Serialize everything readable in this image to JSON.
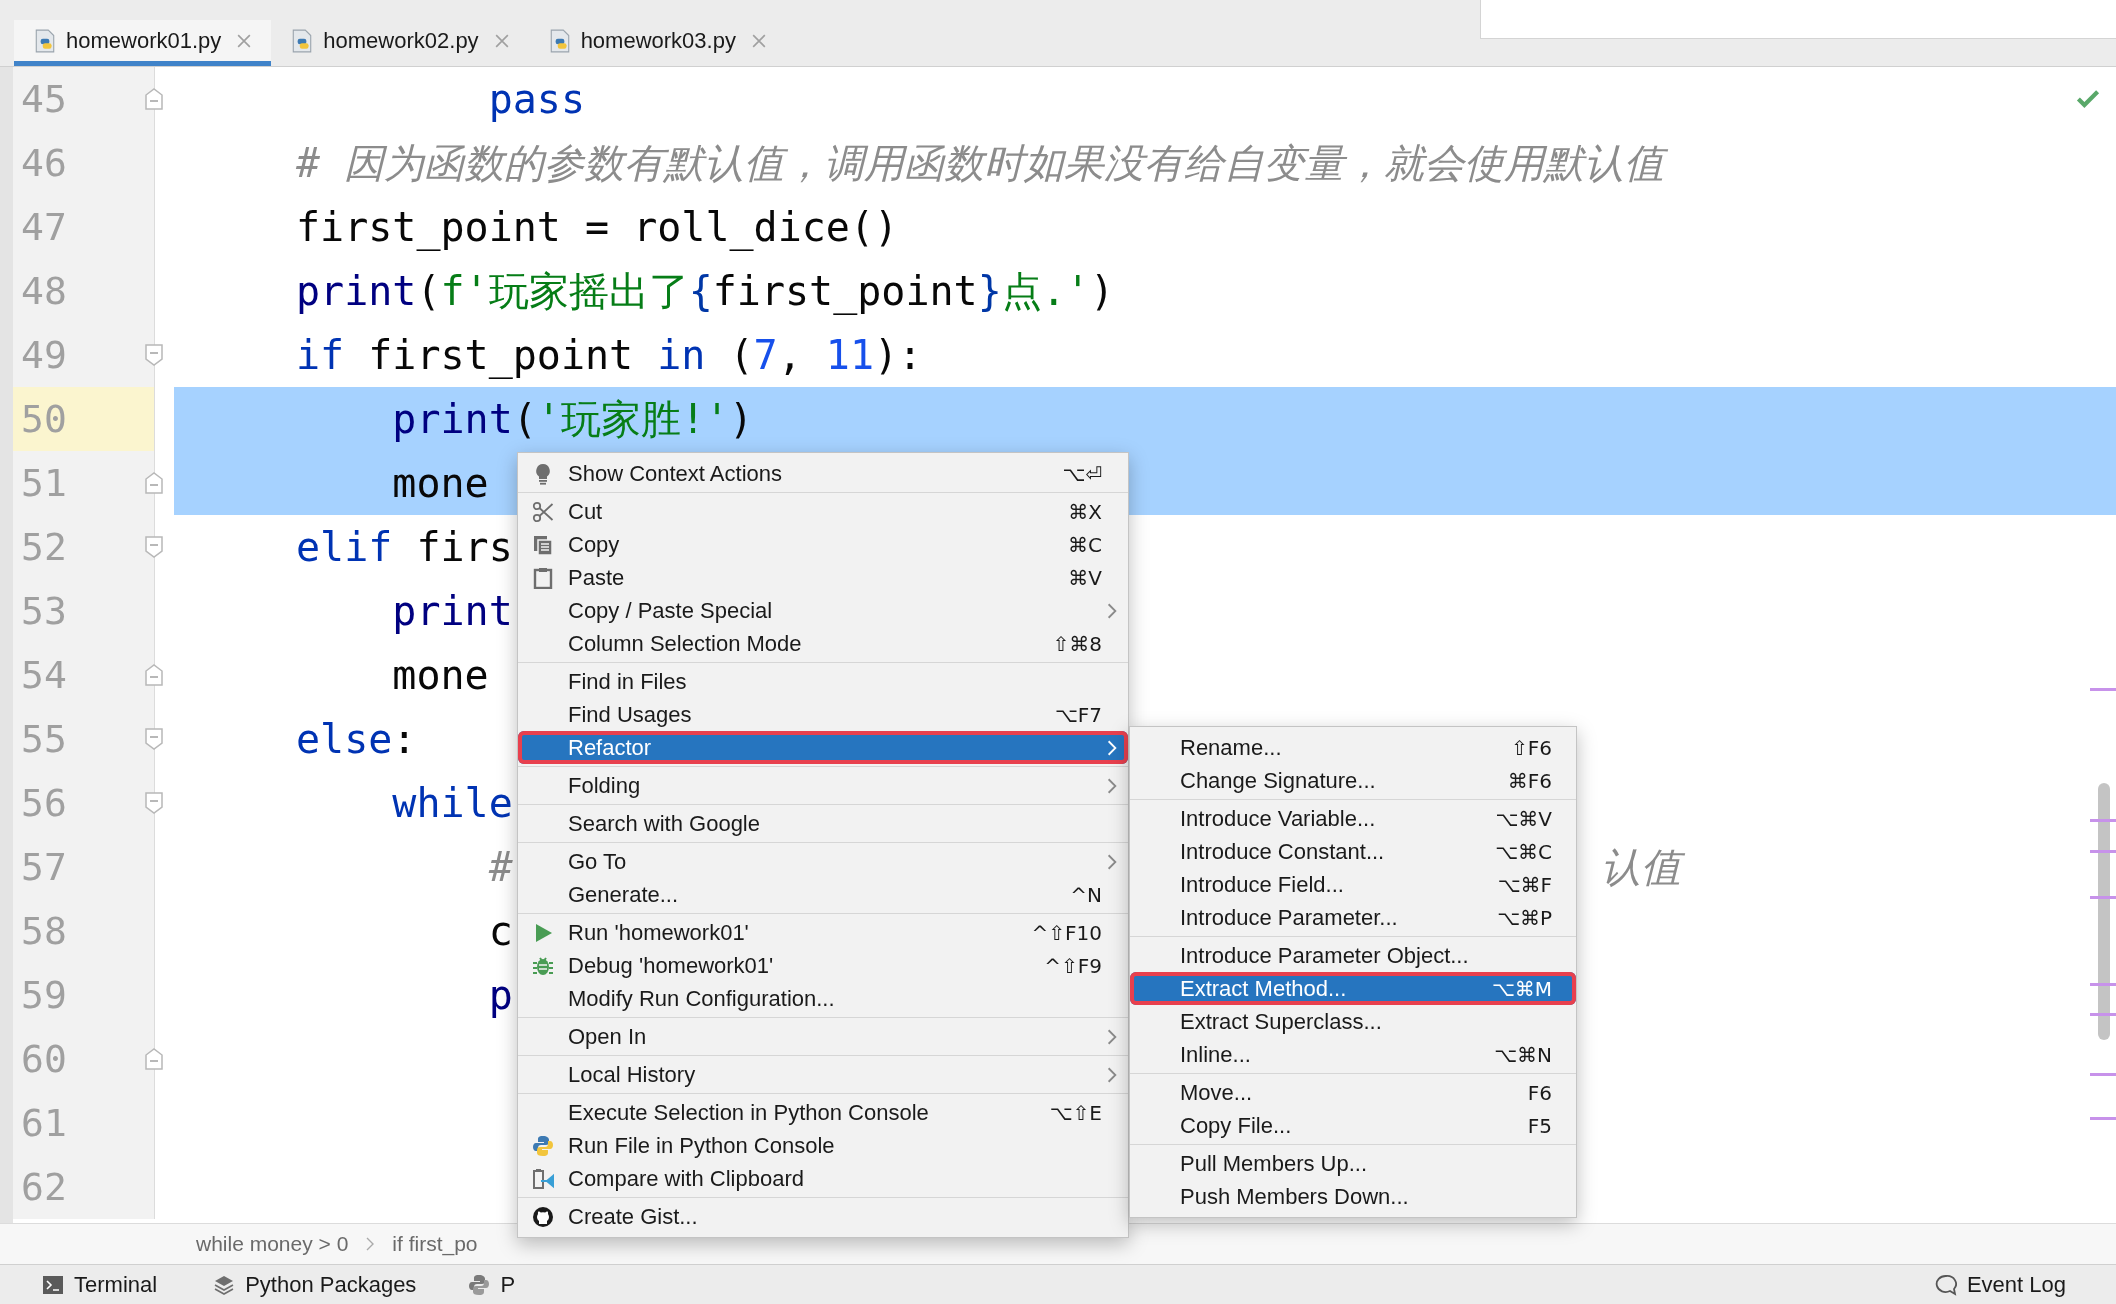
{
  "tabs": [
    {
      "label": "homework01.py",
      "selected": true
    },
    {
      "label": "homework02.py",
      "selected": false
    },
    {
      "label": "homework03.py",
      "selected": false
    }
  ],
  "editor": {
    "lines": [
      {
        "number": "45",
        "kind": "fold-end",
        "current": false,
        "selected": false,
        "tokens": [
          {
            "text": "        pass",
            "kind": "keyword"
          }
        ]
      },
      {
        "number": "46",
        "kind": "plain",
        "current": false,
        "selected": false,
        "tokens": [
          {
            "text": "# 因为函数的参数有默认值，调用函数时如果没有给自变量，就会使用默认值",
            "kind": "comment"
          }
        ]
      },
      {
        "number": "47",
        "kind": "plain",
        "current": false,
        "selected": false,
        "tokens": [
          {
            "text": "first_point = roll_dice()",
            "kind": "plain"
          }
        ]
      },
      {
        "number": "48",
        "kind": "plain",
        "current": false,
        "selected": false,
        "tokens": [
          {
            "text": "print",
            "kind": "builtin"
          },
          {
            "text": "(",
            "kind": "plain"
          },
          {
            "text": "f'玩家摇出了",
            "kind": "string"
          },
          {
            "text": "{",
            "kind": "brace"
          },
          {
            "text": "first_point",
            "kind": "plain"
          },
          {
            "text": "}",
            "kind": "brace"
          },
          {
            "text": "点.'",
            "kind": "string"
          },
          {
            "text": ")",
            "kind": "plain"
          }
        ]
      },
      {
        "number": "49",
        "kind": "fold-start",
        "current": false,
        "selected": false,
        "tokens": [
          {
            "text": "if",
            "kind": "keyword"
          },
          {
            "text": " first_point ",
            "kind": "plain"
          },
          {
            "text": "in",
            "kind": "keyword"
          },
          {
            "text": " (",
            "kind": "plain"
          },
          {
            "text": "7",
            "kind": "number"
          },
          {
            "text": ", ",
            "kind": "plain"
          },
          {
            "text": "11",
            "kind": "number"
          },
          {
            "text": "):",
            "kind": "plain"
          }
        ]
      },
      {
        "number": "50",
        "kind": "plain",
        "current": true,
        "selected": true,
        "tokens": [
          {
            "text": "    print",
            "kind": "builtin"
          },
          {
            "text": "(",
            "kind": "plain"
          },
          {
            "text": "'玩家胜!'",
            "kind": "string"
          },
          {
            "text": ")",
            "kind": "plain"
          }
        ]
      },
      {
        "number": "51",
        "kind": "fold-end",
        "current": false,
        "selected": true,
        "tokens": [
          {
            "text": "    mone",
            "kind": "plain"
          }
        ]
      },
      {
        "number": "52",
        "kind": "fold-start",
        "current": false,
        "selected": false,
        "tokens": [
          {
            "text": "elif",
            "kind": "keyword"
          },
          {
            "text": " firs",
            "kind": "plain"
          }
        ]
      },
      {
        "number": "53",
        "kind": "plain",
        "current": false,
        "selected": false,
        "tokens": [
          {
            "text": "    print",
            "kind": "builtin"
          }
        ]
      },
      {
        "number": "54",
        "kind": "fold-end",
        "current": false,
        "selected": false,
        "tokens": [
          {
            "text": "    mone",
            "kind": "plain"
          }
        ]
      },
      {
        "number": "55",
        "kind": "fold-start",
        "current": false,
        "selected": false,
        "tokens": [
          {
            "text": "else",
            "kind": "keyword"
          },
          {
            "text": ":",
            "kind": "plain"
          }
        ]
      },
      {
        "number": "56",
        "kind": "fold-start",
        "current": false,
        "selected": false,
        "tokens": [
          {
            "text": "    while",
            "kind": "keyword"
          }
        ]
      },
      {
        "number": "57",
        "kind": "plain",
        "current": false,
        "selected": false,
        "tokens": [
          {
            "text": "        #",
            "kind": "comment"
          }
        ],
        "tail": "认值"
      },
      {
        "number": "58",
        "kind": "plain",
        "current": false,
        "selected": false,
        "tokens": [
          {
            "text": "        c",
            "kind": "plain"
          }
        ]
      },
      {
        "number": "59",
        "kind": "plain",
        "current": false,
        "selected": false,
        "tokens": [
          {
            "text": "        p",
            "kind": "builtin"
          }
        ]
      },
      {
        "number": "60",
        "kind": "fold-end",
        "current": false,
        "selected": false
      },
      {
        "number": "61",
        "kind": "plain",
        "current": false,
        "selected": false
      },
      {
        "number": "62",
        "kind": "plain",
        "current": false,
        "selected": false
      }
    ]
  },
  "breadcrumbs": [
    "while money > 0",
    "if first_po"
  ],
  "context_menu": {
    "groups": [
      {
        "items": [
          {
            "label": "Show Context Actions",
            "shortcut": "⌥⏎",
            "submenu": false,
            "selected": false,
            "highlighted": false
          }
        ]
      },
      {
        "items": [
          {
            "label": "Cut",
            "shortcut": "⌘X",
            "submenu": false,
            "selected": false,
            "highlighted": false
          },
          {
            "label": "Copy",
            "shortcut": "⌘C",
            "submenu": false,
            "selected": false,
            "highlighted": false
          },
          {
            "label": "Paste",
            "shortcut": "⌘V",
            "submenu": false,
            "selected": false,
            "highlighted": false
          },
          {
            "label": "Copy / Paste Special",
            "submenu": true,
            "selected": false,
            "highlighted": false
          },
          {
            "label": "Column Selection Mode",
            "shortcut": "⇧⌘8",
            "submenu": false,
            "selected": false,
            "highlighted": false
          }
        ]
      },
      {
        "items": [
          {
            "label": "Find in Files",
            "submenu": false,
            "selected": false,
            "highlighted": false
          },
          {
            "label": "Find Usages",
            "shortcut": "⌥F7",
            "submenu": false,
            "selected": false,
            "highlighted": false
          },
          {
            "label": "Refactor",
            "submenu": true,
            "selected": true,
            "highlighted": true
          }
        ]
      },
      {
        "items": [
          {
            "label": "Folding",
            "submenu": true,
            "selected": false,
            "highlighted": false
          }
        ]
      },
      {
        "items": [
          {
            "label": "Search with Google",
            "submenu": false,
            "selected": false,
            "highlighted": false
          }
        ]
      },
      {
        "items": [
          {
            "label": "Go To",
            "submenu": true,
            "selected": false,
            "highlighted": false
          },
          {
            "label": "Generate...",
            "shortcut": "^N",
            "submenu": false,
            "selected": false,
            "highlighted": false
          }
        ]
      },
      {
        "items": [
          {
            "label": "Run 'homework01'",
            "shortcut": "^⇧F10",
            "submenu": false,
            "selected": false,
            "highlighted": false
          },
          {
            "label": "Debug 'homework01'",
            "shortcut": "^⇧F9",
            "submenu": false,
            "selected": false,
            "highlighted": false
          },
          {
            "label": "Modify Run Configuration...",
            "submenu": false,
            "selected": false,
            "highlighted": false
          }
        ]
      },
      {
        "items": [
          {
            "label": "Open In",
            "submenu": true,
            "selected": false,
            "highlighted": false
          }
        ]
      },
      {
        "items": [
          {
            "label": "Local History",
            "submenu": true,
            "selected": false,
            "highlighted": false
          }
        ]
      },
      {
        "items": [
          {
            "label": "Execute Selection in Python Console",
            "shortcut": "⌥⇧E",
            "submenu": false,
            "selected": false,
            "highlighted": false
          },
          {
            "label": "Run File in Python Console",
            "submenu": false,
            "selected": false,
            "highlighted": false
          },
          {
            "label": "Compare with Clipboard",
            "submenu": false,
            "selected": false,
            "highlighted": false
          }
        ]
      },
      {
        "items": [
          {
            "label": "Create Gist...",
            "submenu": false,
            "selected": false,
            "highlighted": false
          }
        ]
      }
    ]
  },
  "refactor_submenu": {
    "groups": [
      {
        "items": [
          {
            "label": "Rename...",
            "shortcut": "⇧F6",
            "selected": false,
            "highlighted": false
          },
          {
            "label": "Change Signature...",
            "shortcut": "⌘F6",
            "selected": false,
            "highlighted": false
          }
        ]
      },
      {
        "items": [
          {
            "label": "Introduce Variable...",
            "shortcut": "⌥⌘V",
            "selected": false,
            "highlighted": false
          },
          {
            "label": "Introduce Constant...",
            "shortcut": "⌥⌘C",
            "selected": false,
            "highlighted": false
          },
          {
            "label": "Introduce Field...",
            "shortcut": "⌥⌘F",
            "selected": false,
            "highlighted": false
          },
          {
            "label": "Introduce Parameter...",
            "shortcut": "⌥⌘P",
            "selected": false,
            "highlighted": false
          }
        ]
      },
      {
        "items": [
          {
            "label": "Introduce Parameter Object...",
            "selected": false,
            "highlighted": false
          },
          {
            "label": "Extract Method...",
            "shortcut": "⌥⌘M",
            "selected": true,
            "highlighted": true
          },
          {
            "label": "Extract Superclass...",
            "selected": false,
            "highlighted": false
          },
          {
            "label": "Inline...",
            "shortcut": "⌥⌘N",
            "selected": false,
            "highlighted": false
          }
        ]
      },
      {
        "items": [
          {
            "label": "Move...",
            "shortcut": "F6",
            "selected": false,
            "highlighted": false
          },
          {
            "label": "Copy File...",
            "shortcut": "F5",
            "selected": false,
            "highlighted": false
          }
        ]
      },
      {
        "items": [
          {
            "label": "Pull Members Up...",
            "selected": false,
            "highlighted": false
          },
          {
            "label": "Push Members Down...",
            "selected": false,
            "highlighted": false
          }
        ]
      }
    ]
  },
  "tool_windows": [
    {
      "label": "Terminal"
    },
    {
      "label": "Python Packages"
    },
    {
      "label": "P"
    }
  ],
  "event_log": "Event Log"
}
